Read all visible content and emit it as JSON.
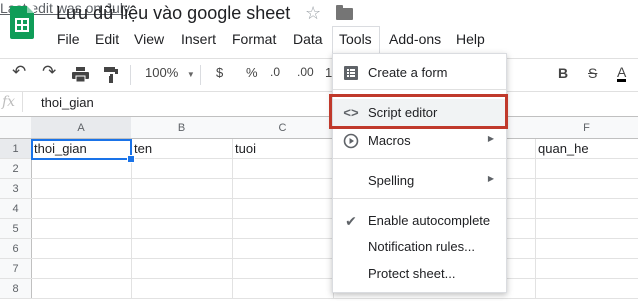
{
  "title_bar": {
    "doc_title": "Lưu dữ liệu vào google sheet",
    "star_icon": "star-outline-icon",
    "folder_icon": "folder-icon"
  },
  "menubar": {
    "items": [
      "File",
      "Edit",
      "View",
      "Insert",
      "Format",
      "Data",
      "Tools",
      "Add-ons",
      "Help"
    ],
    "last_edit": "Last edit was on July"
  },
  "toolbar": {
    "zoom": "100%",
    "currency": "$",
    "percent": "%",
    "decimal_decrease": ".0",
    "decimal_increase": ".00",
    "format_more": "1",
    "bold": "B",
    "strikethrough": "S",
    "text_color": "A"
  },
  "formula_bar": {
    "fx": "fx",
    "value": "thoi_gian"
  },
  "grid": {
    "columns": [
      "A",
      "B",
      "C",
      "F"
    ],
    "rows": [
      "1",
      "2",
      "3",
      "4",
      "5",
      "6",
      "7",
      "8"
    ],
    "row1": {
      "A": "thoi_gian",
      "B": "ten",
      "C": "tuoi",
      "F": "quan_he"
    }
  },
  "tools_menu": {
    "items": [
      {
        "label": "Create a form",
        "icon": "form-icon"
      },
      {
        "label": "Script editor",
        "icon": "code-icon"
      },
      {
        "label": "Macros",
        "icon": "play-circle-icon"
      },
      {
        "label": "Spelling",
        "icon": ""
      },
      {
        "label": "Enable autocomplete",
        "icon": "checkmark-icon"
      },
      {
        "label": "Notification rules...",
        "icon": ""
      },
      {
        "label": "Protect sheet...",
        "icon": ""
      }
    ]
  },
  "colors": {
    "sheets_green": "#0f9d58",
    "selection_blue": "#1a73e8",
    "highlight_red": "#c0392b"
  }
}
